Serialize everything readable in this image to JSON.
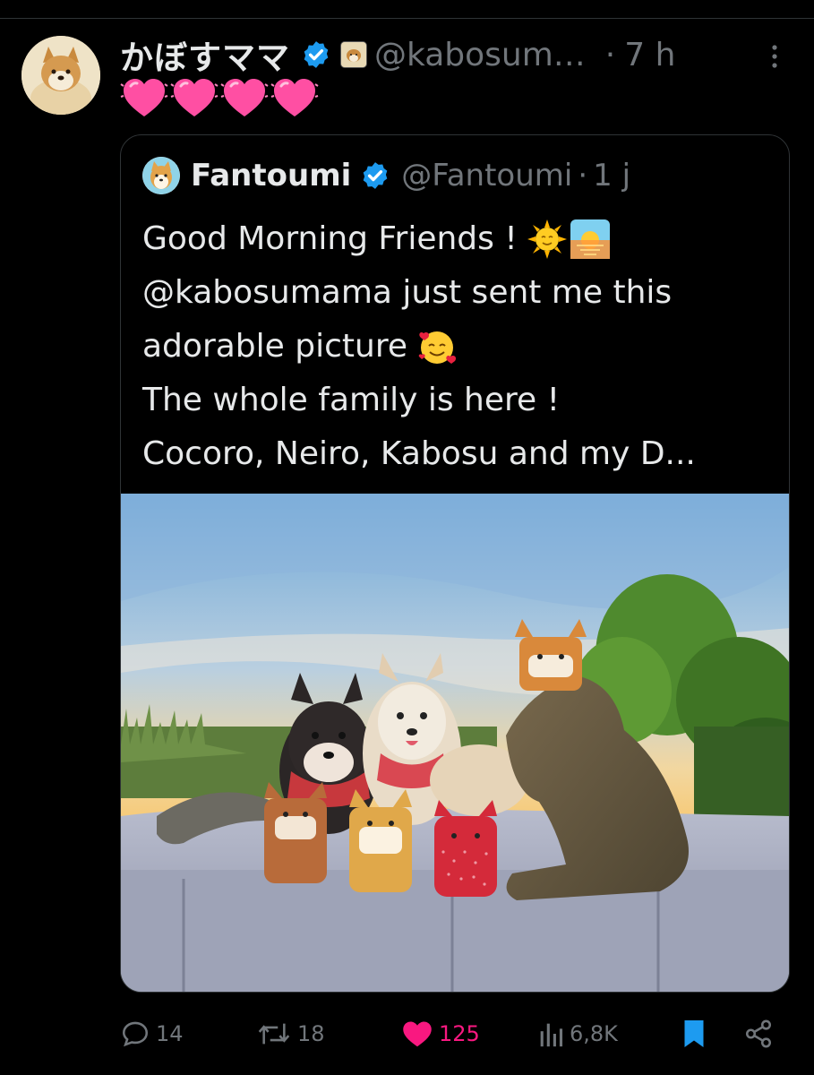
{
  "tweet": {
    "display_name": "かぼすママ",
    "handle": "@kabosum…",
    "separator": "·",
    "time": "7 h",
    "avatar_icon": "shiba-dog-avatar",
    "verified_icon": "verified-badge-icon",
    "affiliation_icon": "shiba-affiliate-badge-icon",
    "text_emojis": [
      "pink-heart-emoji",
      "pink-heart-emoji",
      "pink-heart-emoji",
      "pink-heart-emoji"
    ]
  },
  "quote": {
    "display_name": "Fantoumi",
    "handle": "@Fantoumi",
    "separator": "·",
    "time": "1 j",
    "lines": [
      "Good Morning Friends !",
      "@kabosumama just sent me this",
      "adorable picture",
      "The whole family is here !",
      "Cocoro, Neiro, Kabosu and my D..."
    ],
    "line1_emojis": [
      "sun-with-face-emoji",
      "sunrise-emoji"
    ],
    "line3_emoji": "smiling-face-with-hearts-emoji",
    "photo_subject": "shiba-dogs-and-plush-toys-photo"
  },
  "actions": {
    "replies": "14",
    "reposts": "18",
    "likes": "125",
    "views": "6,8K"
  },
  "colors": {
    "background": "#000000",
    "text": "#e7e9ea",
    "muted": "#71767b",
    "verified": "#1d9bf0",
    "like": "#f91880",
    "border": "#2f3336"
  }
}
